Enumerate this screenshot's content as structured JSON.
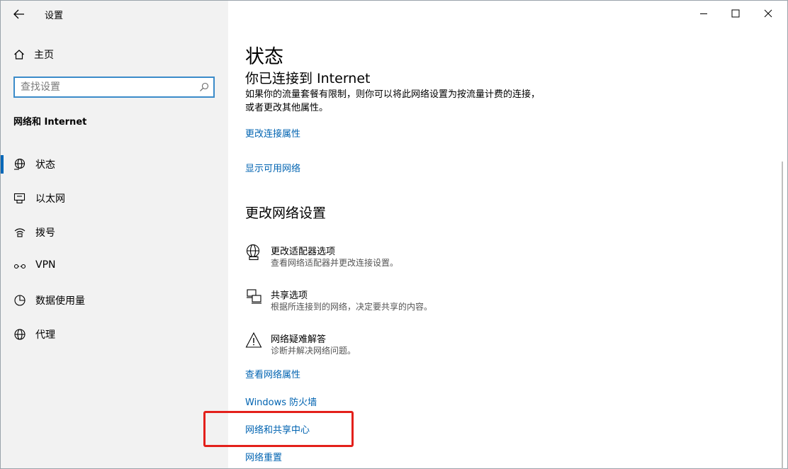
{
  "window": {
    "title": "设置"
  },
  "sidebar": {
    "home_label": "主页",
    "search_placeholder": "查找设置",
    "section_title": "网络和 Internet",
    "items": [
      {
        "label": "状态",
        "icon": "globe-status-icon",
        "active": true
      },
      {
        "label": "以太网",
        "icon": "ethernet-icon",
        "active": false
      },
      {
        "label": "拨号",
        "icon": "dialup-icon",
        "active": false
      },
      {
        "label": "VPN",
        "icon": "vpn-icon",
        "active": false
      },
      {
        "label": "数据使用量",
        "icon": "data-usage-icon",
        "active": false
      },
      {
        "label": "代理",
        "icon": "globe-icon",
        "active": false
      }
    ]
  },
  "main": {
    "title": "状态",
    "connection_heading": "你已连接到 Internet",
    "connection_desc": "如果你的流量套餐有限制，则你可以将此网络设置为按流量计费的连接，或者更改其他属性。",
    "links_top": [
      "更改连接属性",
      "显示可用网络"
    ],
    "change_heading": "更改网络设置",
    "settings": [
      {
        "title": "更改适配器选项",
        "desc": "查看网络适配器并更改连接设置。",
        "icon": "adapter-globe-icon"
      },
      {
        "title": "共享选项",
        "desc": "根据所连接到的网络，决定要共享的内容。",
        "icon": "sharing-icon"
      },
      {
        "title": "网络疑难解答",
        "desc": "诊断并解决网络问题。",
        "icon": "warning-icon"
      }
    ],
    "links_bottom": [
      "查看网络属性",
      "Windows 防火墙",
      "网络和共享中心",
      "网络重置"
    ]
  },
  "colors": {
    "accent": "#0067b8",
    "link": "#0063b1",
    "highlight": "#e3201b",
    "sidebar_bg": "#f2f2f2"
  }
}
